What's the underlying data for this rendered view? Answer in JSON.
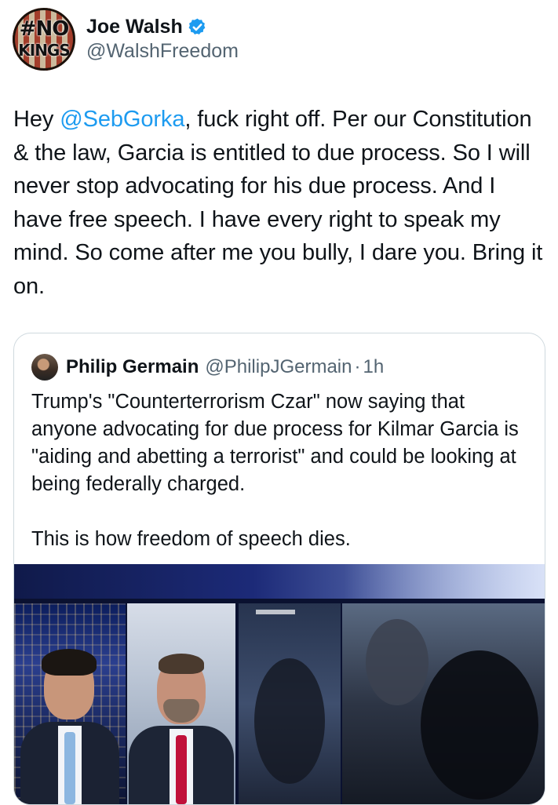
{
  "tweet": {
    "author": {
      "display_name": "Joe Walsh",
      "handle": "@WalshFreedom",
      "verified": true,
      "verified_icon": "verified-badge-icon",
      "verified_color": "#1d9bf0",
      "avatar_text_line1": "#NO",
      "avatar_text_line2": "KINGS"
    },
    "text": {
      "prefix": "Hey ",
      "mention": "@SebGorka",
      "body": ", fuck right off. Per our Constitution & the law, Garcia is entitled to due process. So I will never stop advocating for his due process. And I have free speech. I have every right to speak my mind. So come after me you bully, I dare you. Bring it on."
    }
  },
  "quote": {
    "display_name": "Philip Germain",
    "handle": "@PhilipJGermain",
    "separator": "·",
    "time": "1h",
    "text_paragraph_1": "Trump's \"Counterterrorism Czar\" now saying that anyone advocating for due process for Kilmar Garcia is \"aiding and abetting a terrorist\" and could be looking at being federally charged.",
    "text_paragraph_2": "This is how freedom of speech dies."
  },
  "colors": {
    "text_primary": "#0f1419",
    "text_secondary": "#536471",
    "link": "#1d9bf0",
    "border": "#cfd9de"
  }
}
